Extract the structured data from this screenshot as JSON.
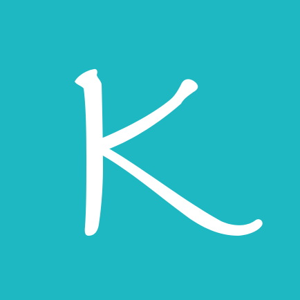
{
  "icon": {
    "letter": "K",
    "background_color": "#1EB8C3",
    "glyph_color": "#FFFFFF"
  }
}
